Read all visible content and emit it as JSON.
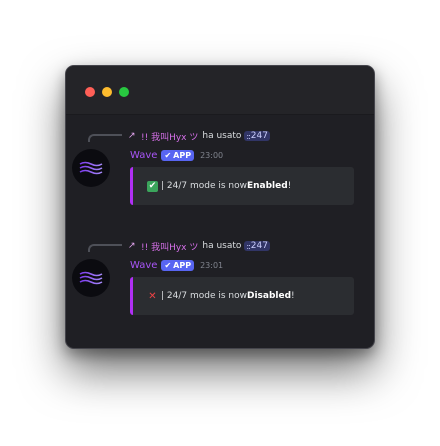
{
  "window": {
    "controls": [
      "close",
      "minimize",
      "zoom"
    ]
  },
  "messages": [
    {
      "reply": {
        "avatar_glyph": "↗",
        "name": "!! 我叫Hyx ツ",
        "text": "ha usato",
        "command_icon": "::",
        "command": "247"
      },
      "author": "Wave",
      "tag_check": "✔",
      "tag": "APP",
      "timestamp": "23:00",
      "embed": {
        "status": "enabled",
        "status_glyph": "✔",
        "text_prefix": "| 24/7 mode is now ",
        "text_strong": "Enabled",
        "text_suffix": "!"
      }
    },
    {
      "reply": {
        "avatar_glyph": "↗",
        "name": "!! 我叫Hyx ツ",
        "text": "ha usato",
        "command_icon": "::",
        "command": "247"
      },
      "author": "Wave",
      "tag_check": "✔",
      "tag": "APP",
      "timestamp": "23:01",
      "embed": {
        "status": "disabled",
        "status_glyph": "✕",
        "text_prefix": "| 24/7 mode is now ",
        "text_strong": "Disabled",
        "text_suffix": "!"
      }
    }
  ],
  "colors": {
    "window_bg": "#1f1f24",
    "reply_name": "#d36ee6",
    "username": "#a855f7",
    "app_tag": "#5865f2",
    "embed_bg": "#2b2d31",
    "embed_border": "#b02ff5",
    "enabled_icon": "#3ba55c",
    "disabled_icon": "#ed4245"
  },
  "icons": {
    "avatar": "wave-logo-icon",
    "enabled": "check-box-icon",
    "disabled": "cross-mark-icon"
  }
}
